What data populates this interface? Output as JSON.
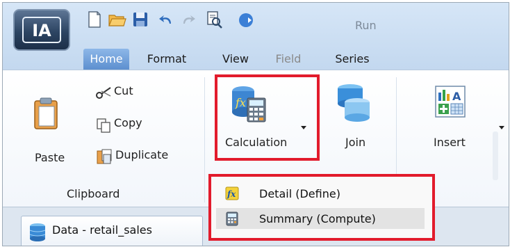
{
  "app": {
    "logo_text": "IA"
  },
  "quick_access": {
    "run_label": "Run",
    "icons": [
      "new-document-icon",
      "open-folder-icon",
      "save-icon",
      "undo-icon",
      "redo-icon",
      "preview-icon",
      "run-icon"
    ]
  },
  "tabs": [
    {
      "label": "Home",
      "active": true
    },
    {
      "label": "Format",
      "active": false
    },
    {
      "label": "View",
      "active": false
    },
    {
      "label": "Field",
      "active": false,
      "disabled": true
    },
    {
      "label": "Series",
      "active": false
    }
  ],
  "clipboard": {
    "group_label": "Clipboard",
    "paste_label": "Paste",
    "cut_label": "Cut",
    "copy_label": "Copy",
    "duplicate_label": "Duplicate"
  },
  "ribbon": {
    "calculation_label": "Calculation",
    "join_label": "Join",
    "insert_label": "Insert"
  },
  "calculation_menu": {
    "items": [
      {
        "label": "Detail (Define)",
        "icon": "fx-detail-icon",
        "highlighted": false
      },
      {
        "label": "Summary (Compute)",
        "icon": "calculator-icon",
        "highlighted": true
      }
    ]
  },
  "bottom": {
    "data_tab_label": "Data - retail_sales"
  },
  "colors": {
    "highlight_box": "#e21b2c",
    "active_tab": "#5d8fcf",
    "ribbon_bg": "#f2f6fb"
  }
}
